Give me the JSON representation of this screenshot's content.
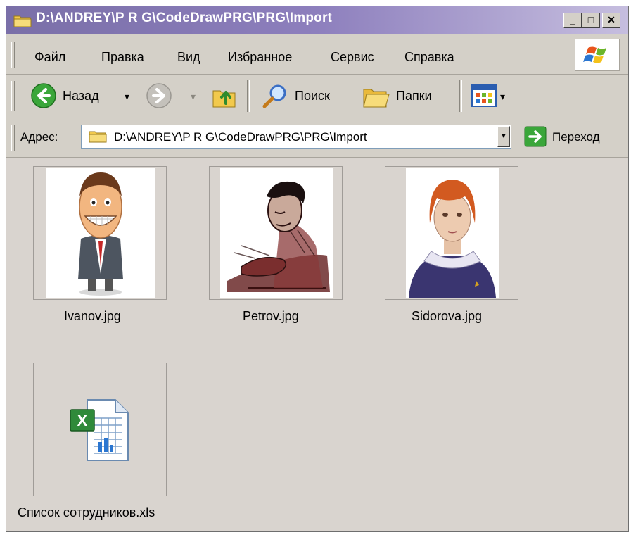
{
  "window": {
    "title": "D:\\ANDREY\\P R G\\CodeDrawPRG\\PRG\\Import",
    "minimize_label": "_",
    "maximize_label": "□",
    "close_label": "✕"
  },
  "menu": {
    "items": [
      {
        "label": "Файл"
      },
      {
        "label": "Правка"
      },
      {
        "label": "Вид"
      },
      {
        "label": "Избранное"
      },
      {
        "label": "Сервис"
      },
      {
        "label": "Справка"
      }
    ]
  },
  "toolbar": {
    "back_label": "Назад",
    "search_label": "Поиск",
    "folders_label": "Папки",
    "dropdown_glyph": "▾"
  },
  "address": {
    "label": "Адрес:",
    "value": "D:\\ANDREY\\P R G\\CodeDrawPRG\\PRG\\Import",
    "go_label": "Переход"
  },
  "files": [
    {
      "name": "Ivanov.jpg",
      "icon": "cartoon-man-photo"
    },
    {
      "name": "Petrov.jpg",
      "icon": "sketch-man-photo"
    },
    {
      "name": "Sidorova.jpg",
      "icon": "woman-portrait-photo"
    },
    {
      "name": "Список сотрудников.xls",
      "icon": "excel-file-icon"
    }
  ],
  "colors": {
    "titlebar_start": "#7a6fa8",
    "window_bg": "#d4d0c8",
    "content_bg": "#d9d4cf"
  }
}
